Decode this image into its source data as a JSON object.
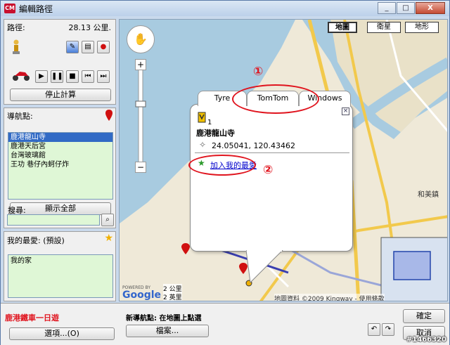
{
  "window": {
    "title": "編輯路徑",
    "app_icon": "CM",
    "controls": [
      "_",
      "□",
      "X"
    ]
  },
  "route": {
    "label": "路徑:",
    "distance": "28.13 公里.",
    "stop_calc_label": "停止計算"
  },
  "waypoints": {
    "label": "導航點:",
    "items": [
      "鹿港龍山寺",
      "鹿港天后宮",
      "台灣玻璃館",
      "王功 巷仔內蚵仔炸"
    ],
    "show_all_label": "顯示全部",
    "search_label": "搜尋:",
    "search_value": ""
  },
  "favorites": {
    "label": "我的最愛: (預設)",
    "items": [
      "我的家"
    ]
  },
  "map": {
    "types": [
      "地圖",
      "衛星",
      "地形"
    ],
    "popup": {
      "tabs": [
        "Tyre",
        "TomTom",
        "Windows"
      ],
      "index": "1",
      "place_name": "鹿港龍山寺",
      "coords": "24.05041, 120.43462",
      "add_favorite_label": "加入我的最愛"
    },
    "annotations": [
      "①",
      "②"
    ],
    "scale": [
      "2 公里",
      "2 英里"
    ],
    "attribution": "地圖資料 ©2009 Kingway - 使用條款",
    "powered_by": "POWERED BY",
    "google_logo": "Google",
    "place_label": "和美鎮"
  },
  "bottom": {
    "trip_name": "鹿港鐵車一日遊",
    "options_label": "選項...(O)",
    "new_point_text": "新導航點: 在地圖上點選",
    "file_label": "檔案...",
    "ok_label": "確定",
    "cancel_label": "取消",
    "watermark": "#1466320"
  },
  "colors": {
    "accent": "#e0141e",
    "list_bg": "#dff7d6",
    "selection": "#316ac5",
    "link": "#0000cc"
  }
}
